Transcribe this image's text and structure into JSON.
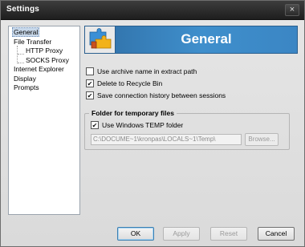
{
  "window": {
    "title": "Settings",
    "close_glyph": "×"
  },
  "tree": {
    "items": [
      {
        "label": "General",
        "level": 0,
        "selected": true
      },
      {
        "label": "File Transfer",
        "level": 0,
        "selected": false
      },
      {
        "label": "HTTP Proxy",
        "level": 1,
        "selected": false
      },
      {
        "label": "SOCKS Proxy",
        "level": 1,
        "selected": false
      },
      {
        "label": "Internet Explorer",
        "level": 0,
        "selected": false
      },
      {
        "label": "Display",
        "level": 0,
        "selected": false
      },
      {
        "label": "Prompts",
        "level": 0,
        "selected": false
      }
    ]
  },
  "header": {
    "title": "General",
    "icon": "puzzle-icon"
  },
  "options": [
    {
      "label": "Use archive name in extract path",
      "checked": false
    },
    {
      "label": "Delete to Recycle Bin",
      "checked": true
    },
    {
      "label": "Save connection history between sessions",
      "checked": true
    }
  ],
  "temp_group": {
    "title": "Folder for temporary files",
    "use_windows_temp_label": "Use Windows TEMP folder",
    "use_windows_temp_checked": true,
    "path_value": "C:\\DOCUME~1\\kronpas\\LOCALS~1\\Temp\\",
    "browse_label": "Browse..."
  },
  "buttons": {
    "ok": "OK",
    "apply": "Apply",
    "reset": "Reset",
    "cancel": "Cancel"
  },
  "colors": {
    "header_blue": "#3f8fcc",
    "titlebar": "#2a2a2a"
  }
}
